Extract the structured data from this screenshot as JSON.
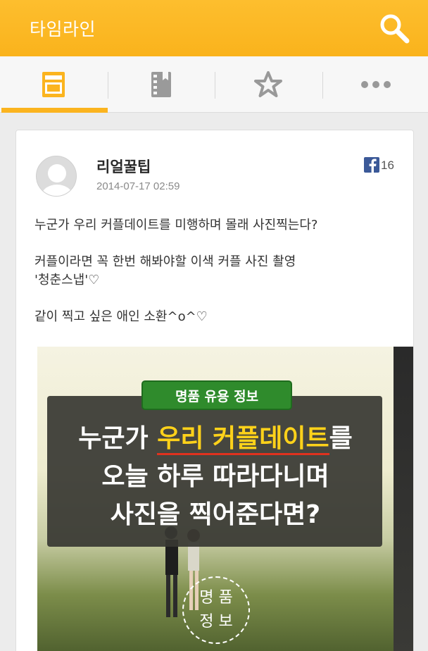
{
  "appbar": {
    "title": "타임라인",
    "search_icon": "search-icon"
  },
  "tabs": [
    {
      "name": "timeline-tab",
      "icon": "newsfeed-icon",
      "active": true
    },
    {
      "name": "notebook-tab",
      "icon": "notebook-icon",
      "active": false
    },
    {
      "name": "favorites-tab",
      "icon": "star-icon",
      "active": false
    },
    {
      "name": "more-tab",
      "icon": "more-dots-icon",
      "active": false
    }
  ],
  "post": {
    "author": "리얼꿀팁",
    "date": "2014-07-17 02:59",
    "facebook_count": "16",
    "paragraphs": [
      "누군가 우리 커플데이트를 미행하며 몰래 사진찍는다?",
      "커플이라면 꼭 한번 해봐야할 이색 커플 사진 촬영\n'청춘스냅'♡",
      "같이 찍고 싶은 애인 소환^o^♡"
    ],
    "image": {
      "tag": "명품 유용 정보",
      "headline_pre": "누군가 ",
      "headline_highlight": "우리 커플데이트",
      "headline_post": "를",
      "headline_line2": "오늘 하루 따라다니며",
      "headline_line3": "사진을 찍어준다면?",
      "stamp_line1": "명 품",
      "stamp_line2": "정 보"
    }
  },
  "colors": {
    "accent": "#fbb41f",
    "facebook": "#3b5998",
    "tag_green": "#2f8b2c",
    "highlight": "#ffd21a"
  }
}
